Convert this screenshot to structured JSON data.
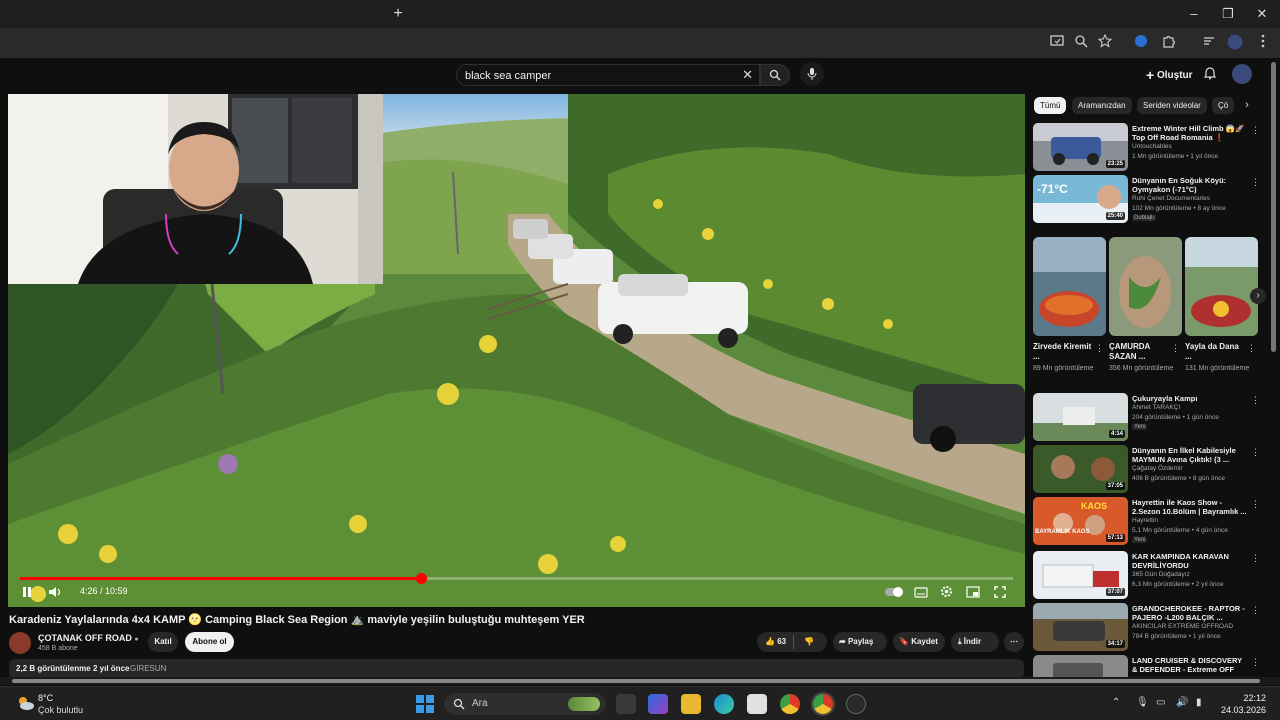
{
  "browser": {
    "new_tab_label": "+",
    "window_controls": {
      "minimize": "–",
      "restore": "❐",
      "close": "✕"
    }
  },
  "header": {
    "search_value": "black sea camper",
    "create_label": "Oluştur"
  },
  "player": {
    "current_time": "4:26",
    "duration": "10:59",
    "time_display": "4:26 / 10:59",
    "progress_fraction": 0.404
  },
  "video": {
    "title": "Karadeniz Yaylalarında 4x4 KAMP 🌝 Camping Black Sea Region ⛰️ maviyle yeşilin buluştuğu muhteşem YER",
    "channel_name": "ÇOTANAK OFF ROAD",
    "subscribers": "458 B abone",
    "join_label": "Katıl",
    "subscribe_label": "Abone ol",
    "likes": "63",
    "share_label": "Paylaş",
    "save_label": "Kaydet",
    "download_label": "İndir",
    "views": "2,2 B görüntülenme",
    "age": "2 yıl önce",
    "location": "GİRESUN"
  },
  "sidebar": {
    "chips": [
      "Tümü",
      "Aramanızdan",
      "Seriden videolar",
      "Çö"
    ],
    "recs": [
      {
        "title": "Extreme Winter Hill Climb 😱🚀 Top Off Road Romania ❗",
        "channel": "Untouchables",
        "meta": "1 Mn görüntüleme • 1 yıl önce",
        "duration": "23:25",
        "badge": ""
      },
      {
        "title": "Dünyanın En Soğuk Köyü: Oymyakon (-71°C)",
        "channel": "Ruhi Çenet Documentaries",
        "meta": "102 Mn görüntüleme • 8 ay önce",
        "duration": "25:40",
        "badge": "Dublajlı"
      },
      {
        "title": "Çukuryayla Kampı",
        "channel": "Ahmet TARAKÇI",
        "meta": "204 görüntüleme • 1 gün önce",
        "duration": "4:14",
        "badge": "Yeni"
      },
      {
        "title": "Dünyanın En İlkel Kabilesiyle MAYMUN Avına Çıktık! (3 ...",
        "channel": "Çağatay Özdemir",
        "meta": "406 B görüntüleme • 8 gün önce",
        "duration": "37:05",
        "badge": ""
      },
      {
        "title": "Hayrettin ile Kaos Show - 2.Sezon 10.Bölüm | Bayramlık ...",
        "channel": "Hayrettin",
        "meta": "5,1 Mn görüntüleme • 4 gün önce",
        "duration": "57:13",
        "badge": "Yeni"
      },
      {
        "title": "KAR KAMPINDA KARAVAN DEVRİLİYORDU",
        "channel": "365 Gün Doğadayız",
        "meta": "6,3 Mn görüntüleme • 2 yıl önce",
        "duration": "37:07",
        "badge": ""
      },
      {
        "title": "GRANDCHEROKEE - RAPTOR - PAJERO -L200 BALÇIK ...",
        "channel": "AKINCILAR EXTREME OFFROAD",
        "meta": "784 B görüntüleme • 1 yıl önce",
        "duration": "34:17",
        "badge": ""
      },
      {
        "title": "LAND CRUISER & DISCOVERY & DEFENDER - Extreme OFF ROAD",
        "channel": "",
        "meta": "",
        "duration": "",
        "badge": ""
      }
    ],
    "thumb_text": {
      "kaos": "KAOS",
      "bayramlik": "BAYRAMLIK KAOS",
      "minus71": "-71°C"
    },
    "shorts": [
      {
        "title": "Zirvede Kiremit ...",
        "views": "89 Mn görüntüleme"
      },
      {
        "title": "ÇAMURDA SAZAN ...",
        "views": "356 Mn görüntüleme"
      },
      {
        "title": "Yayla da Dana ...",
        "views": "131 Mn görüntüleme"
      }
    ]
  },
  "taskbar": {
    "temperature": "8°C",
    "weather": "Çok bulutlu",
    "search_label": "Ara",
    "time": "22:12",
    "date": "24.03.2026"
  },
  "colors": {
    "background": "#0f0f0f",
    "progress": "#ff0000",
    "chip_active": "#f1f1f1"
  }
}
